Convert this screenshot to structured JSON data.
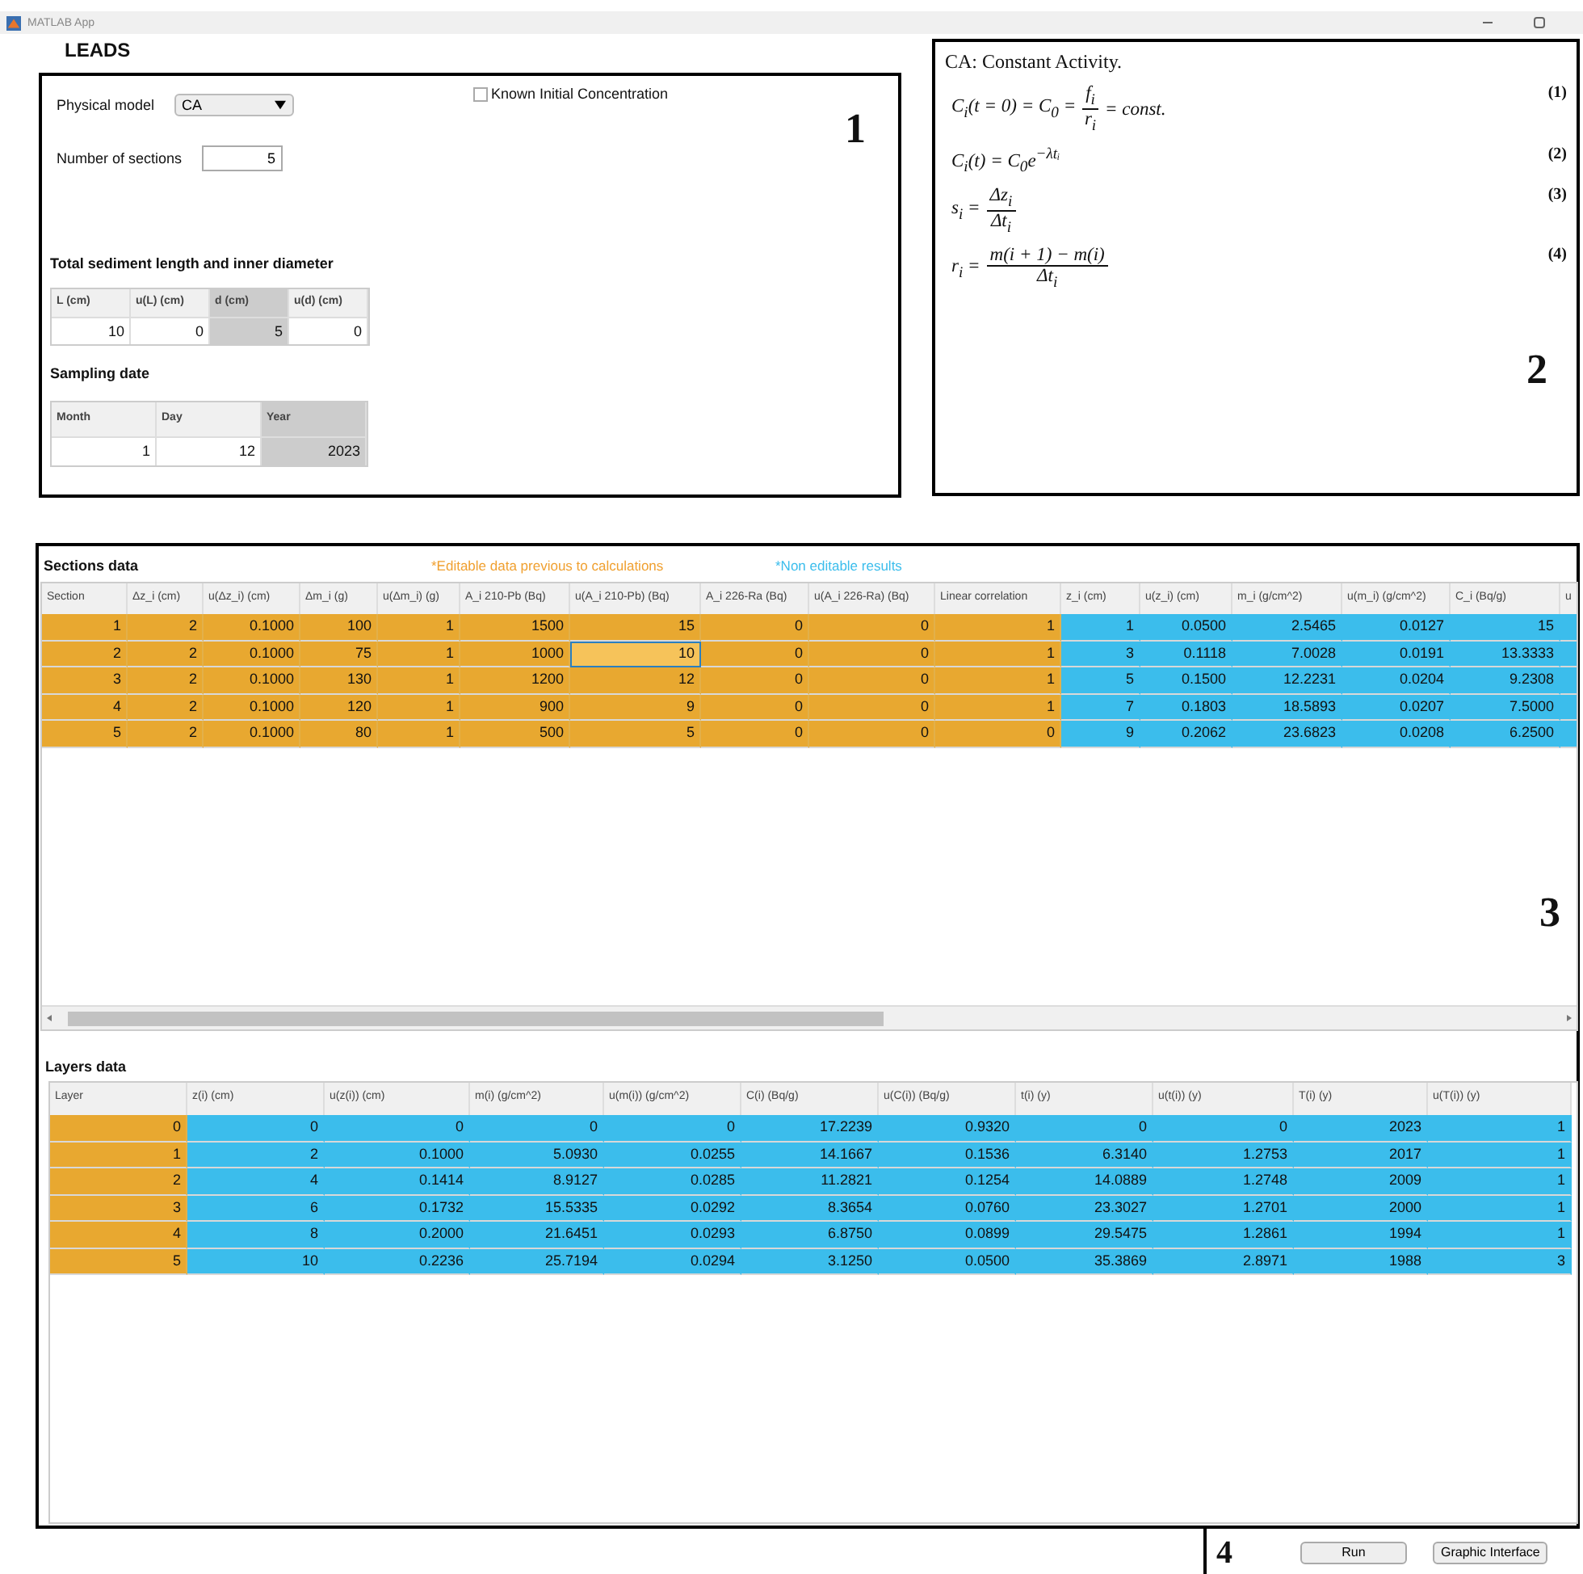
{
  "window": {
    "title": "MATLAB App"
  },
  "app_title": "LEADS",
  "panel_1": {
    "number": "1",
    "physical_model": {
      "label": "Physical model",
      "value": "CA"
    },
    "known_initial_concentration": {
      "label": "Known Initial Concentration",
      "checked": false
    },
    "number_of_sections": {
      "label": "Number of sections",
      "value": "5"
    },
    "sediment": {
      "heading": "Total sediment length and inner diameter",
      "columns": [
        {
          "label": "L (cm)",
          "editable": true
        },
        {
          "label": "u(L) (cm)",
          "editable": true
        },
        {
          "label": "d (cm)",
          "editable": false
        },
        {
          "label": "u(d) (cm)",
          "editable": true
        }
      ],
      "values": [
        "10",
        "0",
        "5",
        "0"
      ]
    },
    "sampling_date": {
      "heading": "Sampling date",
      "columns": [
        {
          "label": "Month",
          "editable": true
        },
        {
          "label": "Day",
          "editable": true
        },
        {
          "label": "Year",
          "editable": false
        }
      ],
      "values": [
        "1",
        "12",
        "2023"
      ]
    }
  },
  "panel_2": {
    "number": "2",
    "heading": "CA: Constant Activity.",
    "equations": [
      {
        "number": "(1)",
        "terms": [
          {
            "kind": "text",
            "text": "C$_{i}$(t = 0) = C$_{0}$ ="
          },
          {
            "kind": "frac",
            "numerator": "f$_{i}$",
            "denominator": "r$_{i}$"
          },
          {
            "kind": "text",
            "text": "= const."
          }
        ]
      },
      {
        "number": "(2)",
        "terms": [
          {
            "kind": "text",
            "text": "C$_{i}$(t) = C$_{0}$e$^{−λtᵢ}$"
          }
        ]
      },
      {
        "number": "(3)",
        "terms": [
          {
            "kind": "text",
            "text": "s$_{i}$ ="
          },
          {
            "kind": "frac",
            "numerator": "Δz$_{i}$",
            "denominator": "Δt$_{i}$"
          }
        ]
      },
      {
        "number": "(4)",
        "terms": [
          {
            "kind": "text",
            "text": "r$_{i}$ ="
          },
          {
            "kind": "frac",
            "numerator": "m(i + 1) − m(i)",
            "denominator": "Δt$_{i}$"
          }
        ]
      }
    ]
  },
  "panel_3": {
    "number": "3",
    "sections": {
      "heading": "Sections data",
      "legend_editable": "*Editable data previous to calculations",
      "legend_results": "*Non editable results",
      "columns": [
        {
          "label": "Section",
          "kind": "editable"
        },
        {
          "label": "Δz_i (cm)",
          "kind": "editable"
        },
        {
          "label": "u(Δz_i) (cm)",
          "kind": "editable"
        },
        {
          "label": "Δm_i (g)",
          "kind": "editable"
        },
        {
          "label": "u(Δm_i) (g)",
          "kind": "editable"
        },
        {
          "label": "A_i 210-Pb (Bq)",
          "kind": "editable"
        },
        {
          "label": "u(A_i 210-Pb) (Bq)",
          "kind": "editable"
        },
        {
          "label": "A_i 226-Ra (Bq)",
          "kind": "editable"
        },
        {
          "label": "u(A_i 226-Ra) (Bq)",
          "kind": "editable"
        },
        {
          "label": "Linear correlation",
          "kind": "editable"
        },
        {
          "label": "z_i (cm)",
          "kind": "result"
        },
        {
          "label": "u(z_i) (cm)",
          "kind": "result"
        },
        {
          "label": "m_i (g/cm^2)",
          "kind": "result"
        },
        {
          "label": "u(m_i) (g/cm^2)",
          "kind": "result"
        },
        {
          "label": "C_i (Bq/g)",
          "kind": "result"
        },
        {
          "label": "u",
          "kind": "result"
        }
      ],
      "rows": [
        {
          "cells": [
            {
              "text": "1",
              "selected": false
            },
            {
              "text": "2",
              "selected": false
            },
            {
              "text": "0.1000",
              "selected": false
            },
            {
              "text": "100",
              "selected": false
            },
            {
              "text": "1",
              "selected": false
            },
            {
              "text": "1500",
              "selected": false
            },
            {
              "text": "15",
              "selected": false
            },
            {
              "text": "0",
              "selected": false
            },
            {
              "text": "0",
              "selected": false
            },
            {
              "text": "1",
              "selected": false
            },
            {
              "text": "1",
              "selected": false
            },
            {
              "text": "0.0500",
              "selected": false
            },
            {
              "text": "2.5465",
              "selected": false
            },
            {
              "text": "0.0127",
              "selected": false
            },
            {
              "text": "15",
              "selected": false
            }
          ]
        },
        {
          "cells": [
            {
              "text": "2",
              "selected": false
            },
            {
              "text": "2",
              "selected": false
            },
            {
              "text": "0.1000",
              "selected": false
            },
            {
              "text": "75",
              "selected": false
            },
            {
              "text": "1",
              "selected": false
            },
            {
              "text": "1000",
              "selected": false
            },
            {
              "text": "10",
              "selected": true
            },
            {
              "text": "0",
              "selected": false
            },
            {
              "text": "0",
              "selected": false
            },
            {
              "text": "1",
              "selected": false
            },
            {
              "text": "3",
              "selected": false
            },
            {
              "text": "0.1118",
              "selected": false
            },
            {
              "text": "7.0028",
              "selected": false
            },
            {
              "text": "0.0191",
              "selected": false
            },
            {
              "text": "13.3333",
              "selected": false
            }
          ]
        },
        {
          "cells": [
            {
              "text": "3",
              "selected": false
            },
            {
              "text": "2",
              "selected": false
            },
            {
              "text": "0.1000",
              "selected": false
            },
            {
              "text": "130",
              "selected": false
            },
            {
              "text": "1",
              "selected": false
            },
            {
              "text": "1200",
              "selected": false
            },
            {
              "text": "12",
              "selected": false
            },
            {
              "text": "0",
              "selected": false
            },
            {
              "text": "0",
              "selected": false
            },
            {
              "text": "1",
              "selected": false
            },
            {
              "text": "5",
              "selected": false
            },
            {
              "text": "0.1500",
              "selected": false
            },
            {
              "text": "12.2231",
              "selected": false
            },
            {
              "text": "0.0204",
              "selected": false
            },
            {
              "text": "9.2308",
              "selected": false
            }
          ]
        },
        {
          "cells": [
            {
              "text": "4",
              "selected": false
            },
            {
              "text": "2",
              "selected": false
            },
            {
              "text": "0.1000",
              "selected": false
            },
            {
              "text": "120",
              "selected": false
            },
            {
              "text": "1",
              "selected": false
            },
            {
              "text": "900",
              "selected": false
            },
            {
              "text": "9",
              "selected": false
            },
            {
              "text": "0",
              "selected": false
            },
            {
              "text": "0",
              "selected": false
            },
            {
              "text": "1",
              "selected": false
            },
            {
              "text": "7",
              "selected": false
            },
            {
              "text": "0.1803",
              "selected": false
            },
            {
              "text": "18.5893",
              "selected": false
            },
            {
              "text": "0.0207",
              "selected": false
            },
            {
              "text": "7.5000",
              "selected": false
            }
          ]
        },
        {
          "cells": [
            {
              "text": "5",
              "selected": false
            },
            {
              "text": "2",
              "selected": false
            },
            {
              "text": "0.1000",
              "selected": false
            },
            {
              "text": "80",
              "selected": false
            },
            {
              "text": "1",
              "selected": false
            },
            {
              "text": "500",
              "selected": false
            },
            {
              "text": "5",
              "selected": false
            },
            {
              "text": "0",
              "selected": false
            },
            {
              "text": "0",
              "selected": false
            },
            {
              "text": "0",
              "selected": false
            },
            {
              "text": "9",
              "selected": false
            },
            {
              "text": "0.2062",
              "selected": false
            },
            {
              "text": "23.6823",
              "selected": false
            },
            {
              "text": "0.0208",
              "selected": false
            },
            {
              "text": "6.2500",
              "selected": false
            }
          ]
        }
      ]
    },
    "layers": {
      "heading": "Layers data",
      "columns": [
        {
          "label": "Layer",
          "kind": "editable"
        },
        {
          "label": "z(i) (cm)",
          "kind": "result"
        },
        {
          "label": "u(z(i)) (cm)",
          "kind": "result"
        },
        {
          "label": "m(i) (g/cm^2)",
          "kind": "result"
        },
        {
          "label": "u(m(i)) (g/cm^2)",
          "kind": "result"
        },
        {
          "label": "C(i) (Bq/g)",
          "kind": "result"
        },
        {
          "label": "u(C(i)) (Bq/g)",
          "kind": "result"
        },
        {
          "label": "t(i) (y)",
          "kind": "result"
        },
        {
          "label": "u(t(i)) (y)",
          "kind": "result"
        },
        {
          "label": "T(i) (y)",
          "kind": "result"
        },
        {
          "label": "u(T(i)) (y)",
          "kind": "result"
        }
      ],
      "rows": [
        [
          "0",
          "0",
          "0",
          "0",
          "0",
          "17.2239",
          "0.9320",
          "0",
          "0",
          "2023",
          "1"
        ],
        [
          "1",
          "2",
          "0.1000",
          "5.0930",
          "0.0255",
          "14.1667",
          "0.1536",
          "6.3140",
          "1.2753",
          "2017",
          "1"
        ],
        [
          "2",
          "4",
          "0.1414",
          "8.9127",
          "0.0285",
          "11.2821",
          "0.1254",
          "14.0889",
          "1.2748",
          "2009",
          "1"
        ],
        [
          "3",
          "6",
          "0.1732",
          "15.5335",
          "0.0292",
          "8.3654",
          "0.0760",
          "23.3027",
          "1.2701",
          "2000",
          "1"
        ],
        [
          "4",
          "8",
          "0.2000",
          "21.6451",
          "0.0293",
          "6.8750",
          "0.0899",
          "29.5475",
          "1.2861",
          "1994",
          "1"
        ],
        [
          "5",
          "10",
          "0.2236",
          "25.7194",
          "0.0294",
          "3.1250",
          "0.0500",
          "35.3869",
          "2.8971",
          "1988",
          "3"
        ]
      ]
    }
  },
  "footer": {
    "number": "4",
    "buttons": [
      "Run",
      "Graphic Interface"
    ]
  }
}
